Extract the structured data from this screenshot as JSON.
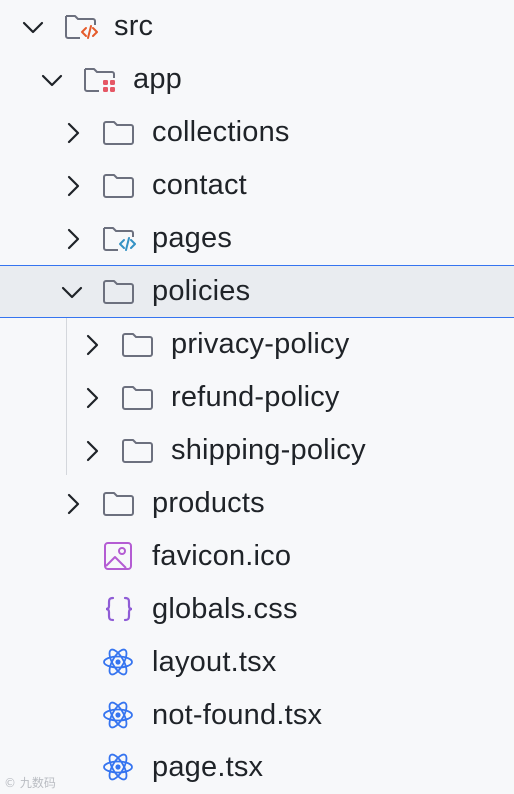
{
  "tree": {
    "items": [
      {
        "label": "src",
        "type": "folder-code-orange",
        "depth": 0,
        "expanded": true
      },
      {
        "label": "app",
        "type": "folder-app",
        "depth": 1,
        "expanded": true
      },
      {
        "label": "collections",
        "type": "folder",
        "depth": 2,
        "expanded": false
      },
      {
        "label": "contact",
        "type": "folder",
        "depth": 2,
        "expanded": false
      },
      {
        "label": "pages",
        "type": "folder-code-blue",
        "depth": 2,
        "expanded": false
      },
      {
        "label": "policies",
        "type": "folder",
        "depth": 2,
        "expanded": true,
        "selected": true
      },
      {
        "label": "privacy-policy",
        "type": "folder",
        "depth": 3,
        "expanded": false
      },
      {
        "label": "refund-policy",
        "type": "folder",
        "depth": 3,
        "expanded": false
      },
      {
        "label": "shipping-policy",
        "type": "folder",
        "depth": 3,
        "expanded": false
      },
      {
        "label": "products",
        "type": "folder",
        "depth": 2,
        "expanded": false
      },
      {
        "label": "favicon.ico",
        "type": "image-file",
        "depth": 2
      },
      {
        "label": "globals.css",
        "type": "css-file",
        "depth": 2
      },
      {
        "label": "layout.tsx",
        "type": "react-file",
        "depth": 2
      },
      {
        "label": "not-found.tsx",
        "type": "react-file",
        "depth": 2
      },
      {
        "label": "page.tsx",
        "type": "react-file",
        "depth": 2
      }
    ]
  },
  "colors": {
    "text": "#1f2328",
    "folder_stroke": "#6c707e",
    "chevron": "#1f2328",
    "selection_bg": "#e9ecf0",
    "selection_border": "#3574f0",
    "code_orange": "#e55b2b",
    "code_blue": "#3592c4",
    "app_dots": "#e55765",
    "image_icon": "#b45cd3",
    "css_icon": "#8f5cd6",
    "react_icon": "#3574f0"
  },
  "watermark": {
    "text": "© 九数码"
  }
}
